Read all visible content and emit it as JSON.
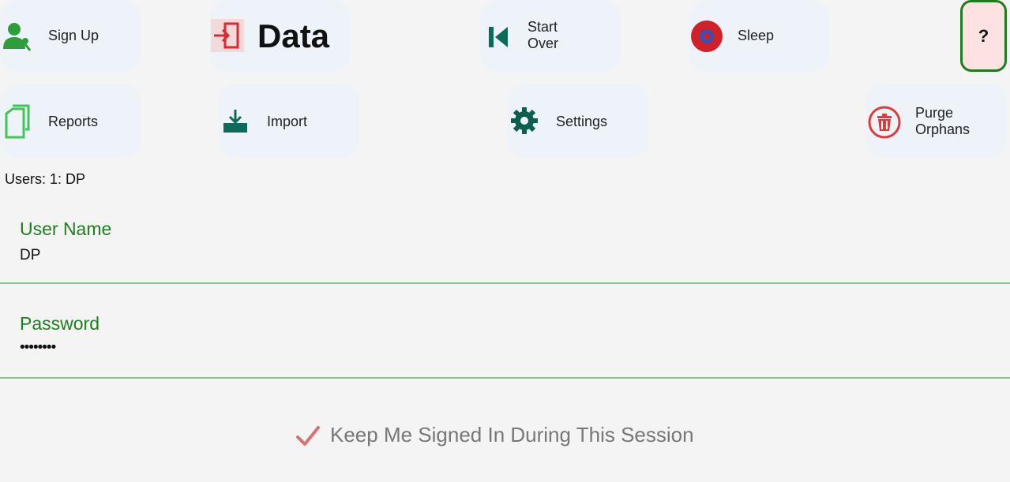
{
  "toolbar": {
    "sign_up": "Sign Up",
    "data": "Data",
    "start_over": [
      "Start",
      "Over"
    ],
    "sleep": "Sleep",
    "help": "?",
    "reports": "Reports",
    "import": "Import",
    "settings": "Settings",
    "purge_orphans": [
      "Purge",
      "Orphans"
    ]
  },
  "users_line": "Users: 1: DP",
  "form": {
    "username_label": "User Name",
    "username_value": "DP",
    "password_label": "Password",
    "password_value": "••••••••",
    "keep_signed_in": "Keep Me Signed In During This Session"
  },
  "colors": {
    "accent_green": "#1e7f1e",
    "tile_bg": "#eef3fa",
    "help_bg": "#fde2e2",
    "purge_red": "#e03a3a",
    "checkmark": "#d97070"
  },
  "icons": [
    "user-add-icon",
    "exit-door-icon",
    "skip-back-icon",
    "sleep-icon",
    "copy-pages-icon",
    "download-tray-icon",
    "gear-icon",
    "trash-icon",
    "checkmark-icon"
  ]
}
